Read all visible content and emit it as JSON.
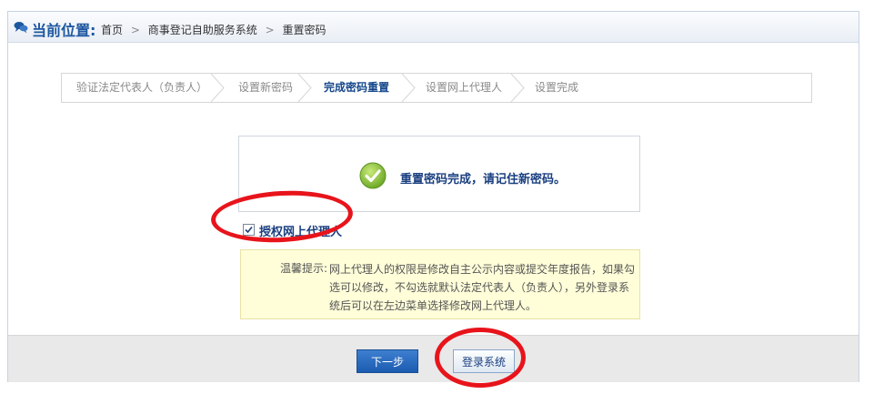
{
  "header": {
    "location_label": "当前位置:",
    "breadcrumb": [
      "首页",
      "商事登记自助服务系统",
      "重置密码"
    ],
    "separator": ">"
  },
  "steps": [
    {
      "label": "验证法定代表人（负责人）",
      "active": false
    },
    {
      "label": "设置新密码",
      "active": false
    },
    {
      "label": "完成密码重置",
      "active": true
    },
    {
      "label": "设置网上代理人",
      "active": false
    },
    {
      "label": "设置完成",
      "active": false
    }
  ],
  "result": {
    "icon": "check-circle-icon",
    "message": "重置密码完成，请记住新密码。"
  },
  "authorize": {
    "checked": true,
    "label": "授权网上代理人"
  },
  "tip": {
    "title": "温馨提示:",
    "text": "网上代理人的权限是修改自主公示内容或提交年度报告，如果勾选可以修改，不勾选就默认法定代表人（负责人），另外登录系统后可以在左边菜单选择修改网上代理人。"
  },
  "buttons": {
    "next": "下一步",
    "login": "登录系统"
  },
  "colors": {
    "accent": "#1d57a0",
    "annotation": "#e8141b",
    "tip_bg": "#fffed9"
  }
}
